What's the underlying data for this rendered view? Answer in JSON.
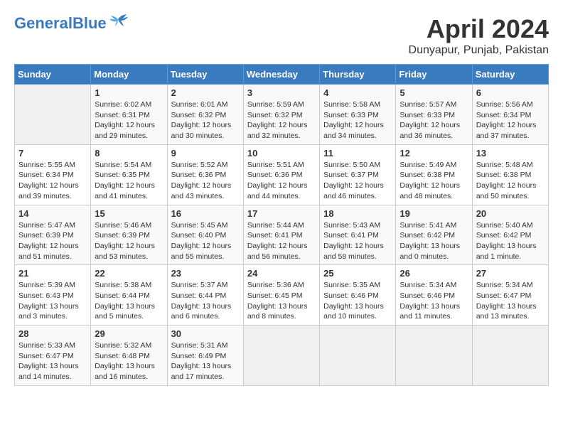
{
  "header": {
    "logo_general": "General",
    "logo_blue": "Blue",
    "main_title": "April 2024",
    "subtitle": "Dunyapur, Punjab, Pakistan"
  },
  "columns": [
    "Sunday",
    "Monday",
    "Tuesday",
    "Wednesday",
    "Thursday",
    "Friday",
    "Saturday"
  ],
  "weeks": [
    [
      {
        "day": "",
        "info": ""
      },
      {
        "day": "1",
        "info": "Sunrise: 6:02 AM\nSunset: 6:31 PM\nDaylight: 12 hours\nand 29 minutes."
      },
      {
        "day": "2",
        "info": "Sunrise: 6:01 AM\nSunset: 6:32 PM\nDaylight: 12 hours\nand 30 minutes."
      },
      {
        "day": "3",
        "info": "Sunrise: 5:59 AM\nSunset: 6:32 PM\nDaylight: 12 hours\nand 32 minutes."
      },
      {
        "day": "4",
        "info": "Sunrise: 5:58 AM\nSunset: 6:33 PM\nDaylight: 12 hours\nand 34 minutes."
      },
      {
        "day": "5",
        "info": "Sunrise: 5:57 AM\nSunset: 6:33 PM\nDaylight: 12 hours\nand 36 minutes."
      },
      {
        "day": "6",
        "info": "Sunrise: 5:56 AM\nSunset: 6:34 PM\nDaylight: 12 hours\nand 37 minutes."
      }
    ],
    [
      {
        "day": "7",
        "info": "Sunrise: 5:55 AM\nSunset: 6:34 PM\nDaylight: 12 hours\nand 39 minutes."
      },
      {
        "day": "8",
        "info": "Sunrise: 5:54 AM\nSunset: 6:35 PM\nDaylight: 12 hours\nand 41 minutes."
      },
      {
        "day": "9",
        "info": "Sunrise: 5:52 AM\nSunset: 6:36 PM\nDaylight: 12 hours\nand 43 minutes."
      },
      {
        "day": "10",
        "info": "Sunrise: 5:51 AM\nSunset: 6:36 PM\nDaylight: 12 hours\nand 44 minutes."
      },
      {
        "day": "11",
        "info": "Sunrise: 5:50 AM\nSunset: 6:37 PM\nDaylight: 12 hours\nand 46 minutes."
      },
      {
        "day": "12",
        "info": "Sunrise: 5:49 AM\nSunset: 6:38 PM\nDaylight: 12 hours\nand 48 minutes."
      },
      {
        "day": "13",
        "info": "Sunrise: 5:48 AM\nSunset: 6:38 PM\nDaylight: 12 hours\nand 50 minutes."
      }
    ],
    [
      {
        "day": "14",
        "info": "Sunrise: 5:47 AM\nSunset: 6:39 PM\nDaylight: 12 hours\nand 51 minutes."
      },
      {
        "day": "15",
        "info": "Sunrise: 5:46 AM\nSunset: 6:39 PM\nDaylight: 12 hours\nand 53 minutes."
      },
      {
        "day": "16",
        "info": "Sunrise: 5:45 AM\nSunset: 6:40 PM\nDaylight: 12 hours\nand 55 minutes."
      },
      {
        "day": "17",
        "info": "Sunrise: 5:44 AM\nSunset: 6:41 PM\nDaylight: 12 hours\nand 56 minutes."
      },
      {
        "day": "18",
        "info": "Sunrise: 5:43 AM\nSunset: 6:41 PM\nDaylight: 12 hours\nand 58 minutes."
      },
      {
        "day": "19",
        "info": "Sunrise: 5:41 AM\nSunset: 6:42 PM\nDaylight: 13 hours\nand 0 minutes."
      },
      {
        "day": "20",
        "info": "Sunrise: 5:40 AM\nSunset: 6:42 PM\nDaylight: 13 hours\nand 1 minute."
      }
    ],
    [
      {
        "day": "21",
        "info": "Sunrise: 5:39 AM\nSunset: 6:43 PM\nDaylight: 13 hours\nand 3 minutes."
      },
      {
        "day": "22",
        "info": "Sunrise: 5:38 AM\nSunset: 6:44 PM\nDaylight: 13 hours\nand 5 minutes."
      },
      {
        "day": "23",
        "info": "Sunrise: 5:37 AM\nSunset: 6:44 PM\nDaylight: 13 hours\nand 6 minutes."
      },
      {
        "day": "24",
        "info": "Sunrise: 5:36 AM\nSunset: 6:45 PM\nDaylight: 13 hours\nand 8 minutes."
      },
      {
        "day": "25",
        "info": "Sunrise: 5:35 AM\nSunset: 6:46 PM\nDaylight: 13 hours\nand 10 minutes."
      },
      {
        "day": "26",
        "info": "Sunrise: 5:34 AM\nSunset: 6:46 PM\nDaylight: 13 hours\nand 11 minutes."
      },
      {
        "day": "27",
        "info": "Sunrise: 5:34 AM\nSunset: 6:47 PM\nDaylight: 13 hours\nand 13 minutes."
      }
    ],
    [
      {
        "day": "28",
        "info": "Sunrise: 5:33 AM\nSunset: 6:47 PM\nDaylight: 13 hours\nand 14 minutes."
      },
      {
        "day": "29",
        "info": "Sunrise: 5:32 AM\nSunset: 6:48 PM\nDaylight: 13 hours\nand 16 minutes."
      },
      {
        "day": "30",
        "info": "Sunrise: 5:31 AM\nSunset: 6:49 PM\nDaylight: 13 hours\nand 17 minutes."
      },
      {
        "day": "",
        "info": ""
      },
      {
        "day": "",
        "info": ""
      },
      {
        "day": "",
        "info": ""
      },
      {
        "day": "",
        "info": ""
      }
    ]
  ]
}
